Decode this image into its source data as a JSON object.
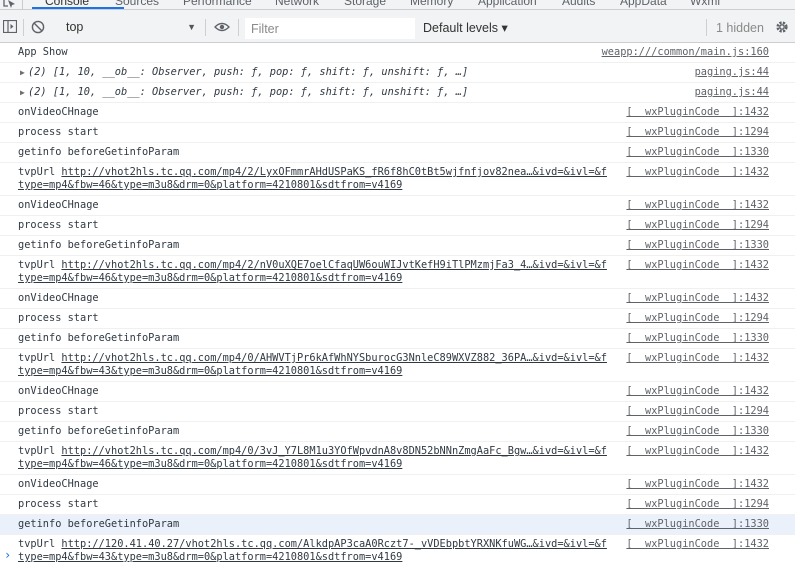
{
  "tabs": [
    "Console",
    "Sources",
    "Performance",
    "Network",
    "Storage",
    "Memory",
    "Application",
    "Audits",
    "AppData",
    "Wxml"
  ],
  "toolbar": {
    "context": "top",
    "filter_placeholder": "Filter",
    "levels": "Default levels ▾",
    "hidden": "1 hidden"
  },
  "messages": [
    {
      "text": "App Show",
      "source": "weapp:///common/main.js:160"
    },
    {
      "text_prefix": "(2) ",
      "text_obj": "[1, 10, __ob__: Observer, push: ƒ, pop: ƒ, shift: ƒ, unshift: ƒ, …]",
      "source": "paging.js:44",
      "expandable": true
    },
    {
      "text_prefix": "(2) ",
      "text_obj": "[1, 10, __ob__: Observer, push: ƒ, pop: ƒ, shift: ƒ, unshift: ƒ, …]",
      "source": "paging.js:44",
      "expandable": true
    },
    {
      "text": "onVideoCHnage",
      "source": "[  wxPluginCode  ]:1432"
    },
    {
      "text": "process start",
      "source": "[  wxPluginCode  ]:1294"
    },
    {
      "text": "getinfo beforeGetinfoParam",
      "source": "[  wxPluginCode  ]:1330"
    },
    {
      "text": "tvpUrl ",
      "url": "http://vhot2hls.tc.qq.com/mp4/2/LyxOFmmrAHdUSPaKS_fR6f8hC0tBt5wjfnfjov82nea…&ivd=&ivl=&ftype=mp4&fbw=46&type=m3u8&drm=0&platform=4210801&sdtfrom=v4169",
      "source": "[  wxPluginCode  ]:1432"
    },
    {
      "text": "onVideoCHnage",
      "source": "[  wxPluginCode  ]:1432"
    },
    {
      "text": "process start",
      "source": "[  wxPluginCode  ]:1294"
    },
    {
      "text": "getinfo beforeGetinfoParam",
      "source": "[  wxPluginCode  ]:1330"
    },
    {
      "text": "tvpUrl ",
      "url": "http://vhot2hls.tc.qq.com/mp4/2/nV0uXQE7oelCfaqUW6ouWIJvtKefH9iTlPMzmjFa3_4…&ivd=&ivl=&ftype=mp4&fbw=46&type=m3u8&drm=0&platform=4210801&sdtfrom=v4169",
      "source": "[  wxPluginCode  ]:1432"
    },
    {
      "text": "onVideoCHnage",
      "source": "[  wxPluginCode  ]:1432"
    },
    {
      "text": "process start",
      "source": "[  wxPluginCode  ]:1294"
    },
    {
      "text": "getinfo beforeGetinfoParam",
      "source": "[  wxPluginCode  ]:1330"
    },
    {
      "text": "tvpUrl ",
      "url": "http://vhot2hls.tc.qq.com/mp4/0/AHWVTjPr6kAfWhNYSburocG3NnleC89WXVZ882_36PA…&ivd=&ivl=&ftype=mp4&fbw=43&type=m3u8&drm=0&platform=4210801&sdtfrom=v4169",
      "source": "[  wxPluginCode  ]:1432"
    },
    {
      "text": "onVideoCHnage",
      "source": "[  wxPluginCode  ]:1432"
    },
    {
      "text": "process start",
      "source": "[  wxPluginCode  ]:1294"
    },
    {
      "text": "getinfo beforeGetinfoParam",
      "source": "[  wxPluginCode  ]:1330"
    },
    {
      "text": "tvpUrl ",
      "url": "http://vhot2hls.tc.qq.com/mp4/0/3vJ_Y7L8M1u3YOfWpvdnA8v8DN52bNNnZmgAaFc_Bgw…&ivd=&ivl=&ftype=mp4&fbw=46&type=m3u8&drm=0&platform=4210801&sdtfrom=v4169",
      "source": "[  wxPluginCode  ]:1432"
    },
    {
      "text": "onVideoCHnage",
      "source": "[  wxPluginCode  ]:1432"
    },
    {
      "text": "process start",
      "source": "[  wxPluginCode  ]:1294"
    },
    {
      "text": "getinfo beforeGetinfoParam",
      "source": "[  wxPluginCode  ]:1330",
      "selected": true
    },
    {
      "text": "tvpUrl ",
      "url": "http://120.41.40.27/vhot2hls.tc.qq.com/AlkdpAP3caA0Rczt7-_vVDEbpbtYRXNKfuWG…&ivd=&ivl=&ftype=mp4&fbw=43&type=m3u8&drm=0&platform=4210801&sdtfrom=v4169",
      "source": "[  wxPluginCode  ]:1432"
    }
  ],
  "prompt": "›"
}
